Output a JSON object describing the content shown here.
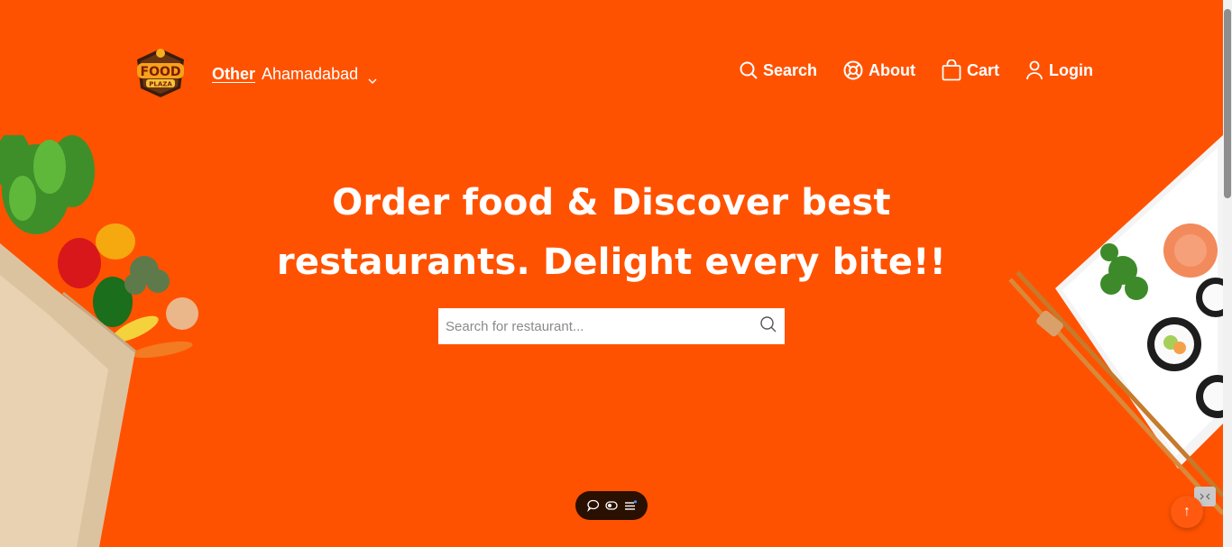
{
  "brand": {
    "logo_top": "FOOD",
    "logo_bottom": "PLAZA"
  },
  "location": {
    "type": "Other",
    "city": "Ahamadabad"
  },
  "nav": {
    "search": "Search",
    "about": "About",
    "cart": "Cart",
    "login": "Login"
  },
  "hero": {
    "line1": "Order food & Discover best",
    "line2": "restaurants. Delight every bite!!"
  },
  "search": {
    "placeholder": "Search for restaurant..."
  },
  "back_to_top": "↑",
  "colors": {
    "brand_orange": "#ff5200",
    "toolbar_dark": "#2a1000"
  }
}
